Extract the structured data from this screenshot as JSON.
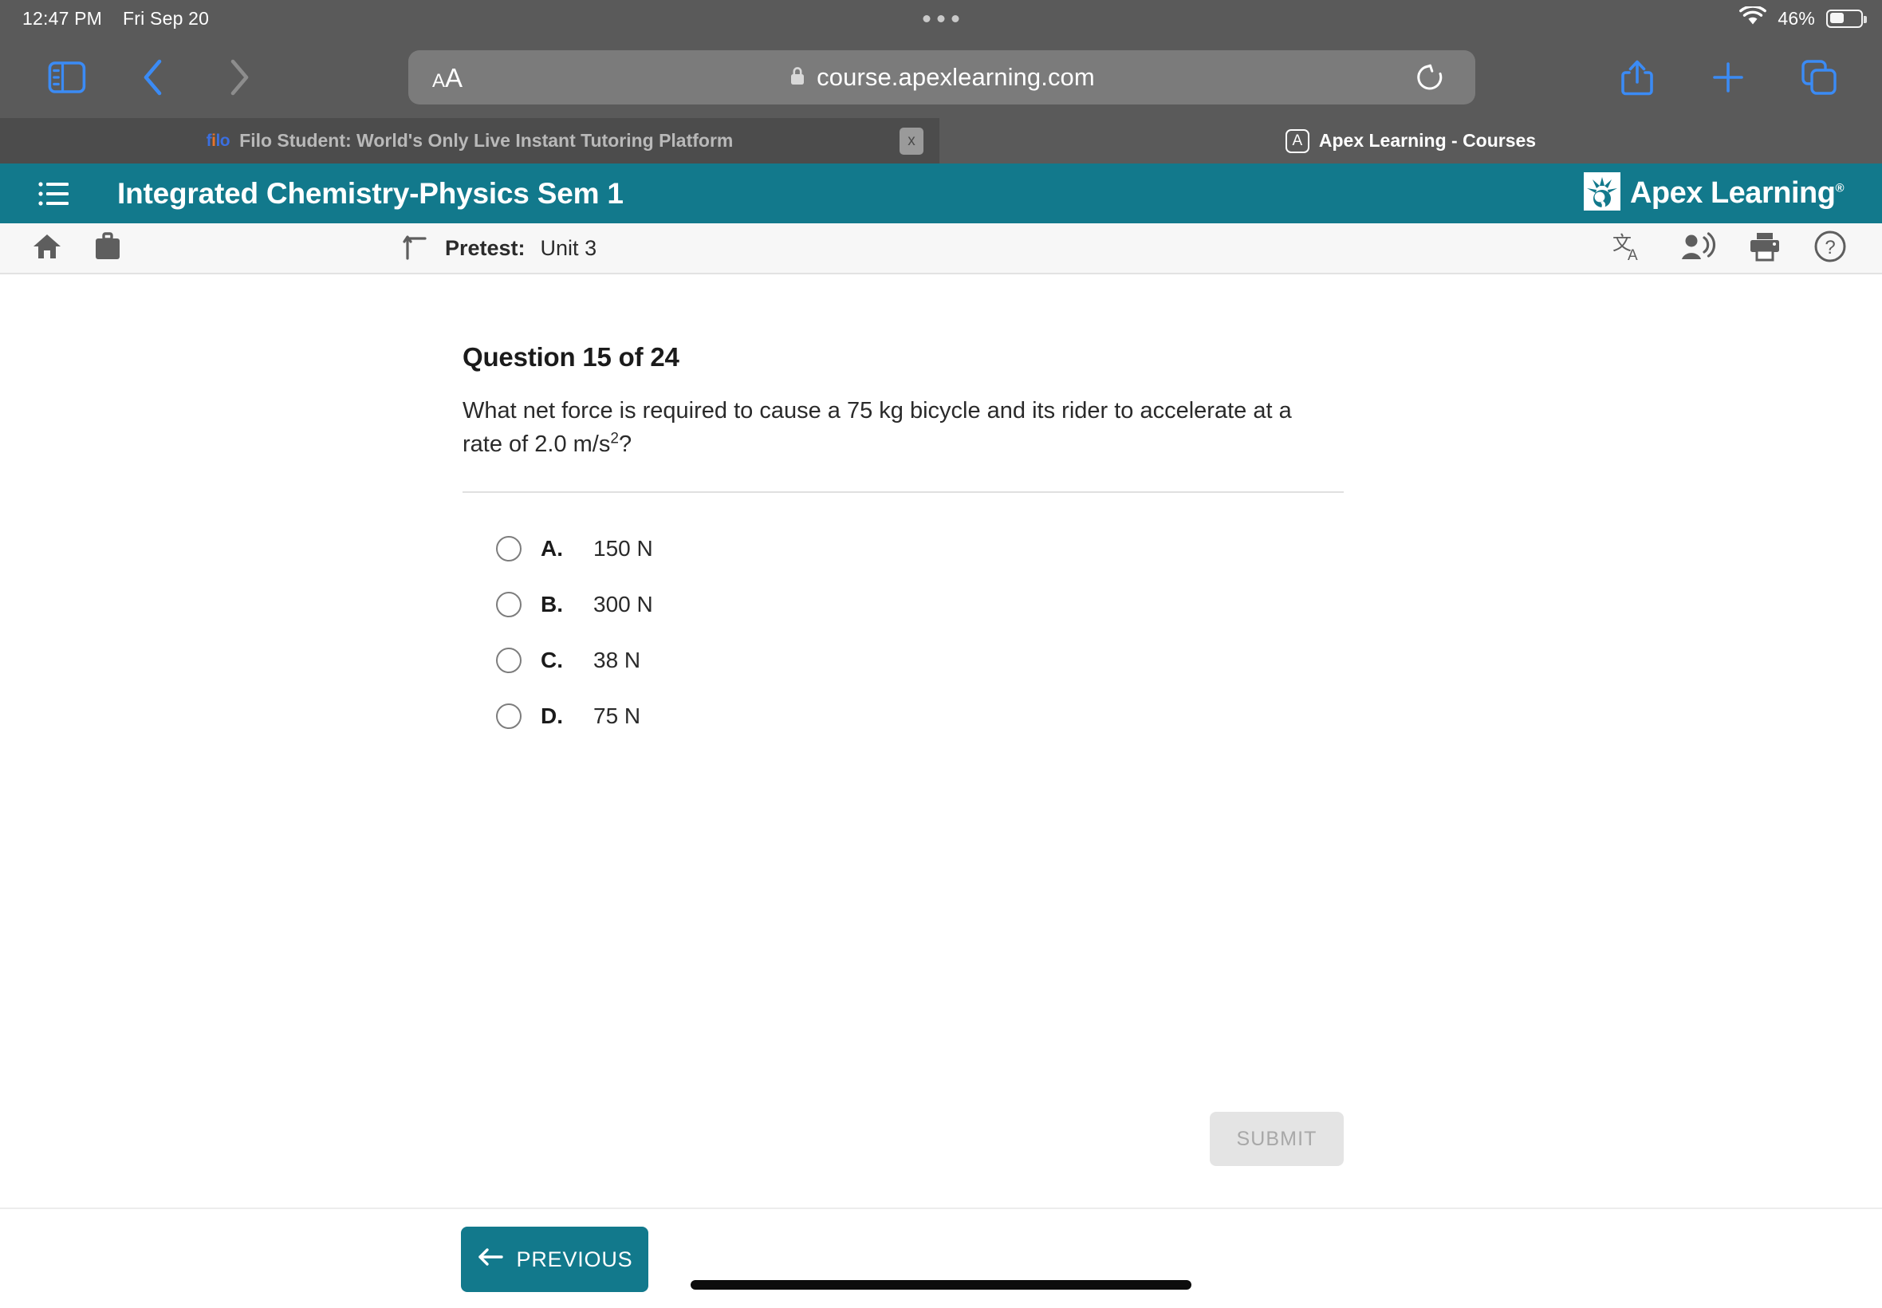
{
  "status_bar": {
    "time": "12:47 PM",
    "date": "Fri Sep 20",
    "battery_percent": "46%",
    "wifi_icon": "wifi-icon",
    "battery_icon": "battery-icon"
  },
  "browser": {
    "sidebar_icon": "sidebar-icon",
    "back_icon": "chevron-left-icon",
    "forward_icon": "chevron-right-icon",
    "text_size_small": "A",
    "text_size_large": "A",
    "lock_icon": "lock-icon",
    "url": "course.apexlearning.com",
    "reload_icon": "reload-icon",
    "share_icon": "share-icon",
    "new_tab_icon": "plus-icon",
    "tabs_icon": "tabs-icon",
    "tabs": [
      {
        "title": "Filo Student: World's Only Live Instant Tutoring Platform",
        "favicon": "filo-favicon",
        "favicon_text": "filo",
        "active": false,
        "close_label": "x"
      },
      {
        "title": "Apex Learning - Courses",
        "favicon": "apex-favicon",
        "favicon_text": "A",
        "active": true
      }
    ]
  },
  "app_header": {
    "menu_icon": "hamburger-menu-icon",
    "course_title": "Integrated Chemistry-Physics Sem 1",
    "logo_text": "Apex Learning",
    "logo_trademark": "®",
    "logo_icon": "apex-sunburst-logo-icon",
    "background_color": "#12798c"
  },
  "sub_toolbar": {
    "home_icon": "home-icon",
    "briefcase_icon": "briefcase-icon",
    "level_up_icon": "level-up-arrow-icon",
    "activity_label": "Pretest:",
    "activity_value": "Unit 3",
    "translate_icon": "translate-icon",
    "read_aloud_icon": "read-aloud-icon",
    "print_icon": "print-icon",
    "help_icon": "help-icon"
  },
  "question": {
    "heading": "Question 15 of 24",
    "number": 15,
    "total": 24,
    "text_before_sup": "What net force is required to cause a 75 kg bicycle and its rider to accelerate at a rate of 2.0 m/s",
    "superscript": "2",
    "text_after_sup": "?",
    "options": [
      {
        "letter": "A.",
        "text": "150 N",
        "selected": false
      },
      {
        "letter": "B.",
        "text": "300 N",
        "selected": false
      },
      {
        "letter": "C.",
        "text": "38 N",
        "selected": false
      },
      {
        "letter": "D.",
        "text": "75 N",
        "selected": false
      }
    ],
    "submit_label": "SUBMIT",
    "submit_enabled": false
  },
  "bottom_nav": {
    "previous_label": "PREVIOUS",
    "previous_icon": "arrow-left-icon",
    "accent_color": "#12798c"
  }
}
